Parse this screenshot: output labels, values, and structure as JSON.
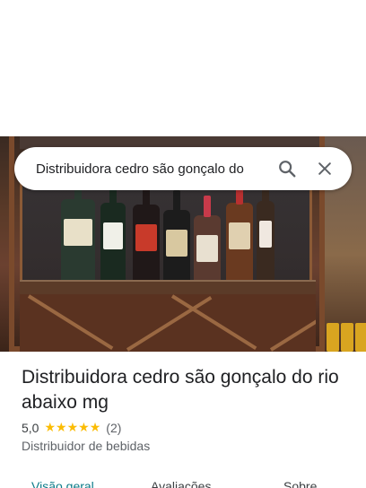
{
  "search": {
    "query": "Distribuidora cedro são gonçalo do",
    "search_icon": "search-icon",
    "close_icon": "close-icon"
  },
  "place": {
    "name": "Distribuidora cedro são gonçalo do rio abaixo mg",
    "rating": "5,0",
    "stars": 5,
    "review_count": "(2)",
    "category": "Distribuidor de bebidas"
  },
  "tabs": [
    {
      "label": "Visão geral",
      "active": true
    },
    {
      "label": "Avaliações",
      "active": false
    },
    {
      "label": "Sobre",
      "active": false
    }
  ],
  "colors": {
    "star": "#fbbc04",
    "active_tab": "#0b7b88"
  }
}
